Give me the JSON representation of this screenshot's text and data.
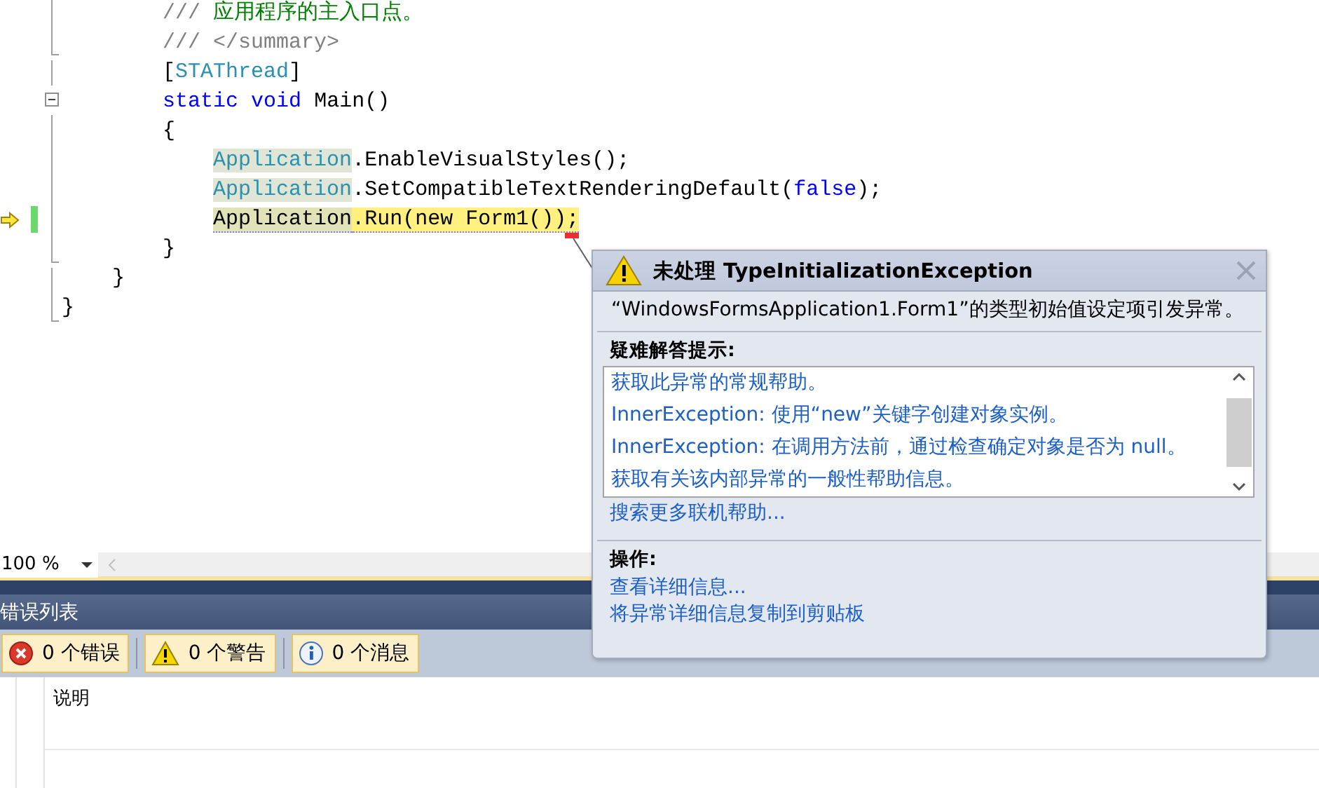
{
  "editor": {
    "lines": [
      {
        "tokens": [
          {
            "text": "        ///",
            "kind": "doc"
          },
          {
            "text": " 应用程序的主入口点。",
            "kind": "comment"
          }
        ],
        "current": false
      },
      {
        "tokens": [
          {
            "text": "        /// </summary>",
            "kind": "doc"
          }
        ],
        "current": false
      },
      {
        "tokens": [
          {
            "text": "        [",
            "kind": "plain"
          },
          {
            "text": "STAThread",
            "kind": "type"
          },
          {
            "text": "]",
            "kind": "plain"
          }
        ],
        "current": false
      },
      {
        "tokens": [
          {
            "text": "        static void",
            "kind": "keyword"
          },
          {
            "text": " Main()",
            "kind": "plain"
          }
        ],
        "current": false
      },
      {
        "tokens": [
          {
            "text": "        {",
            "kind": "plain"
          }
        ],
        "current": false
      },
      {
        "tokens": [
          {
            "text": "            Application",
            "kind": "type",
            "shaded": true
          },
          {
            "text": ".EnableVisualStyles();",
            "kind": "plain"
          }
        ],
        "current": false
      },
      {
        "tokens": [
          {
            "text": "            Application",
            "kind": "type",
            "shaded": true
          },
          {
            "text": ".SetCompatibleTextRenderingDefault(",
            "kind": "plain"
          },
          {
            "text": "false",
            "kind": "keyword"
          },
          {
            "text": ");",
            "kind": "plain"
          }
        ],
        "current": false
      },
      {
        "tokens": [
          {
            "text": "            Application",
            "kind": "plain",
            "shaded": true
          },
          {
            "text": ".Run(new Form1());",
            "kind": "plain"
          }
        ],
        "current": true
      },
      {
        "tokens": [
          {
            "text": "        }",
            "kind": "plain"
          }
        ],
        "current": false
      },
      {
        "tokens": [
          {
            "text": "    }",
            "kind": "plain"
          }
        ],
        "current": false
      },
      {
        "tokens": [
          {
            "text": "}",
            "kind": "plain"
          }
        ],
        "current": false
      }
    ]
  },
  "zoom": {
    "value": "100 %"
  },
  "error_list": {
    "title": "错误列表",
    "filters": [
      {
        "kind": "error",
        "label": "0 个错误",
        "selected": true
      },
      {
        "kind": "warning",
        "label": "0 个警告",
        "selected": true
      },
      {
        "kind": "info",
        "label": "0 个消息",
        "selected": true
      }
    ],
    "columns": [
      {
        "label": "说明"
      }
    ]
  },
  "exception_popup": {
    "title": "未处理 TypeInitializationException",
    "message": "“WindowsFormsApplication1.Form1”的类型初始值设定项引发异常。",
    "troubleshooting": {
      "heading": "疑难解答提示:",
      "tips": [
        "获取此异常的常规帮助。",
        "InnerException: 使用“new”关键字创建对象实例。",
        "InnerException: 在调用方法前，通过检查确定对象是否为 null。",
        "获取有关该内部异常的一般性帮助信息。"
      ],
      "more_link": "搜索更多联机帮助..."
    },
    "actions": {
      "heading": "操作:",
      "links": [
        "查看详细信息...",
        "将异常详细信息复制到剪贴板"
      ]
    }
  }
}
